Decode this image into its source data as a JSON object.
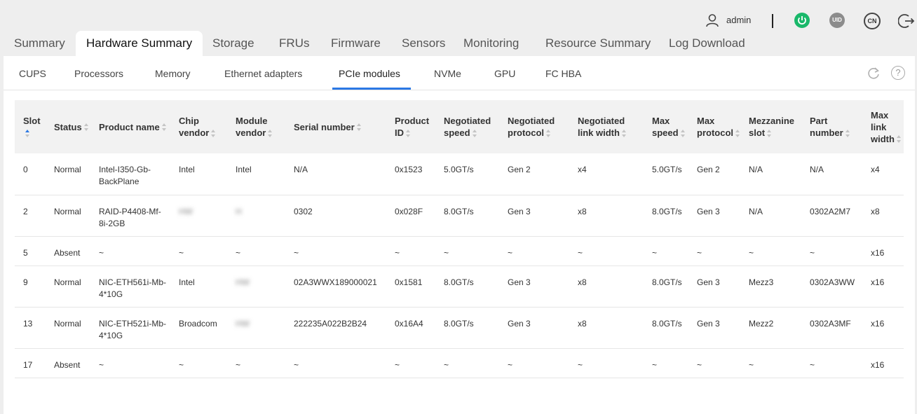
{
  "user": {
    "name": "admin",
    "uid_label": "UID",
    "lang_label": "CN"
  },
  "main_tabs": [
    "Summary",
    "Hardware Summary",
    "Storage",
    "FRUs",
    "Firmware",
    "Sensors",
    "Monitoring",
    "Resource Summary",
    "Log Download"
  ],
  "active_main_tab": "Hardware Summary",
  "sub_tabs": [
    "CUPS",
    "Processors",
    "Memory",
    "Ethernet adapters",
    "PCIe modules",
    "NVMe",
    "GPU",
    "FC HBA"
  ],
  "active_sub_tab": "PCIe modules",
  "help_label": "?",
  "table": {
    "columns": [
      [
        "Slot"
      ],
      [
        "Status"
      ],
      [
        "Product name"
      ],
      [
        "Chip",
        "vendor"
      ],
      [
        "Module",
        "vendor"
      ],
      [
        "Serial number"
      ],
      [
        "Product",
        "ID"
      ],
      [
        "Negotiated",
        "speed"
      ],
      [
        "Negotiated",
        "protocol"
      ],
      [
        "Negotiated",
        "link width"
      ],
      [
        "Max",
        "speed"
      ],
      [
        "Max",
        "protocol"
      ],
      [
        "Mezzanine",
        "slot"
      ],
      [
        "Part",
        "number"
      ],
      [
        "Max",
        "link",
        "width"
      ]
    ],
    "rows": [
      [
        "0",
        "Normal",
        "Intel-I350-Gb-BackPlane",
        "Intel",
        "Intel",
        "N/A",
        "0x1523",
        "5.0GT/s",
        "Gen 2",
        "x4",
        "5.0GT/s",
        "Gen 2",
        "N/A",
        "N/A",
        "x4"
      ],
      [
        "2",
        "Normal",
        "RAID-P4408-Mf-8i-2GB",
        "HW",
        "H",
        "0302",
        "0x028F",
        "8.0GT/s",
        "Gen 3",
        "x8",
        "8.0GT/s",
        "Gen 3",
        "N/A",
        "0302A2M7",
        "x8"
      ],
      [
        "5",
        "Absent",
        "~",
        "~",
        "~",
        "~",
        "~",
        "~",
        "~",
        "~",
        "~",
        "~",
        "~",
        "~",
        "x16"
      ],
      [
        "9",
        "Normal",
        "NIC-ETH561i-Mb-4*10G",
        "Intel",
        "HW",
        "02A3WWX189000021",
        "0x1581",
        "8.0GT/s",
        "Gen 3",
        "x8",
        "8.0GT/s",
        "Gen 3",
        "Mezz3",
        "0302A3WW",
        "x16"
      ],
      [
        "13",
        "Normal",
        "NIC-ETH521i-Mb-4*10G",
        "Broadcom",
        "HW",
        "222235A022B2B24",
        "0x16A4",
        "8.0GT/s",
        "Gen 3",
        "x8",
        "8.0GT/s",
        "Gen 3",
        "Mezz2",
        "0302A3MF",
        "x16"
      ],
      [
        "17",
        "Absent",
        "~",
        "~",
        "~",
        "~",
        "~",
        "~",
        "~",
        "~",
        "~",
        "~",
        "~",
        "~",
        "x16"
      ]
    ],
    "blurred_cells": [
      [
        1,
        3
      ],
      [
        1,
        4
      ],
      [
        3,
        4
      ],
      [
        4,
        4
      ]
    ]
  },
  "colors": {
    "accent": "#2b78e4",
    "power": "#19b86a",
    "uid": "#8c8c8c"
  },
  "icons": [
    "user-icon",
    "power-icon",
    "uid-icon",
    "language-icon",
    "logout-icon",
    "refresh-icon",
    "help-icon",
    "sort-icon"
  ]
}
